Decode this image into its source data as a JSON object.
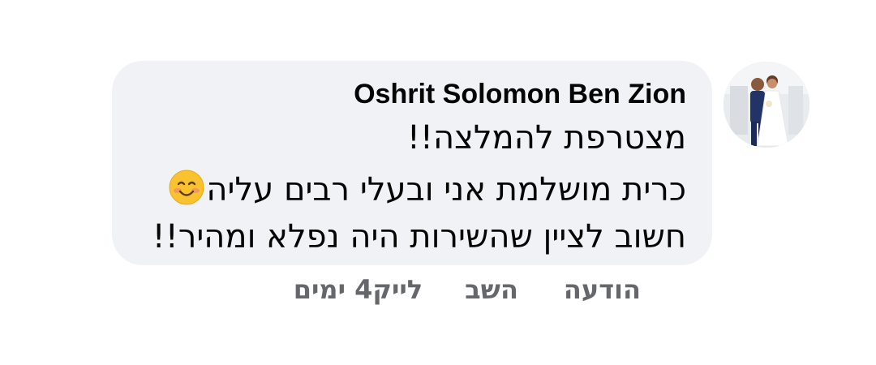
{
  "comment": {
    "author": "Oshrit Solomon Ben Zion",
    "lines": [
      "מצטרפת להמלצה!!",
      "כרית מושלמת אני ובעלי רבים עליה",
      "חשוב לציין שהשירות היה  נפלא ומהיר!!"
    ],
    "emoji_icon": "smiling-face-emoji",
    "avatar_icon": "wedding-couple-photo"
  },
  "actions": {
    "time": "4 ימים",
    "like": "לייק",
    "reply": "השב",
    "message": "הודעה"
  },
  "colors": {
    "bubble": "#f0f2f5",
    "text": "#050505",
    "muted": "#65676b"
  }
}
